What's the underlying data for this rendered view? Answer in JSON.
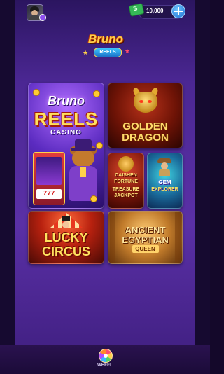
{
  "header": {
    "balance": "10,000",
    "add_currency_label": "+"
  },
  "logo": {
    "brand_top": "Bruno",
    "brand_bottom": "REELS"
  },
  "games": [
    {
      "lines": [
        "Bruno",
        "REELS",
        "CASINO"
      ],
      "reels": "777"
    },
    {
      "lines": [
        "GOLDEN",
        "DRAGON"
      ]
    },
    {
      "lines": [
        "CAISHEN",
        "FORTUNE",
        "TREASURE",
        "JACKPOT"
      ]
    },
    {
      "lines": [
        "GEM",
        "EXPLORER"
      ]
    },
    {
      "lines": [
        "LUCKY",
        "CIRCUS"
      ]
    },
    {
      "lines": [
        "ANCIENT",
        "EGYPTIAN",
        "QUEEN"
      ]
    }
  ],
  "bottom_nav": {
    "wheel_label": "WHEEL"
  },
  "colors": {
    "accent_gold": "#ffd54a",
    "panel_purple": "#5a30a6",
    "cash_green": "#35b857",
    "plus_blue": "#1c6fd1"
  },
  "icons": {
    "avatar": "user-avatar-icon",
    "currency": "cash-icon",
    "add": "plus-icon",
    "wheel": "wheel-icon"
  }
}
